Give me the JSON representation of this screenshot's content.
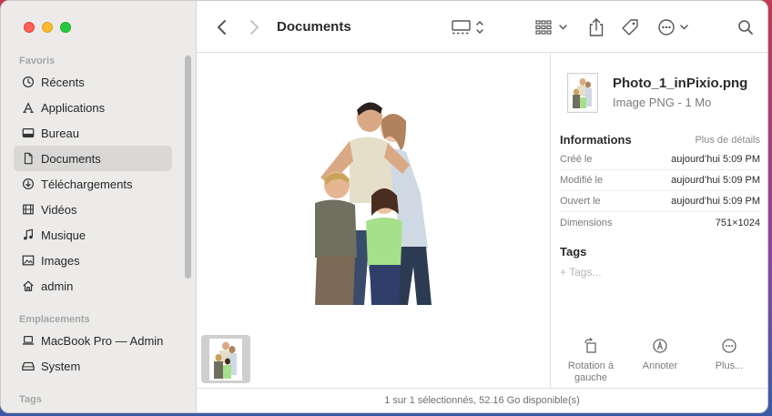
{
  "window": {
    "title": "Documents"
  },
  "sidebar": {
    "sections": {
      "favorites": "Favoris",
      "locations": "Emplacements",
      "tags": "Tags"
    },
    "favorites": [
      {
        "label": "Récents",
        "icon": "clock-icon"
      },
      {
        "label": "Applications",
        "icon": "applications-icon"
      },
      {
        "label": "Bureau",
        "icon": "desktop-icon"
      },
      {
        "label": "Documents",
        "icon": "document-icon",
        "selected": true
      },
      {
        "label": "Téléchargements",
        "icon": "download-icon"
      },
      {
        "label": "Vidéos",
        "icon": "film-icon"
      },
      {
        "label": "Musique",
        "icon": "music-note-icon"
      },
      {
        "label": "Images",
        "icon": "photo-icon"
      },
      {
        "label": "admin",
        "icon": "home-icon"
      }
    ],
    "locations": [
      {
        "label": "MacBook Pro — Admin",
        "icon": "laptop-icon"
      },
      {
        "label": "System",
        "icon": "drive-icon"
      }
    ]
  },
  "toolbar": {
    "back_icon": "chevron-left-icon",
    "forward_icon": "chevron-right-icon",
    "view_icon": "gallery-view-icon",
    "group_icon": "grid-group-icon",
    "share_icon": "share-icon",
    "tag_icon": "tag-icon",
    "more_icon": "ellipsis-circle-icon",
    "search_icon": "search-icon"
  },
  "info": {
    "file_name": "Photo_1_inPixio.png",
    "file_kind": "Image PNG - 1 Mo",
    "section_title": "Informations",
    "more_details": "Plus de détails",
    "rows": [
      {
        "key": "Créé le",
        "value": "aujourd’hui 5:09 PM"
      },
      {
        "key": "Modifié le",
        "value": "aujourd’hui 5:09 PM"
      },
      {
        "key": "Ouvert le",
        "value": "aujourd’hui 5:09 PM"
      },
      {
        "key": "Dimensions",
        "value": "751×1024"
      }
    ],
    "tags_title": "Tags",
    "tags_placeholder": "+ Tags..."
  },
  "actions": [
    {
      "label": "Rotation à gauche",
      "icon": "rotate-left-icon"
    },
    {
      "label": "Annoter",
      "icon": "markup-icon"
    },
    {
      "label": "Plus...",
      "icon": "more-icon"
    }
  ],
  "status": {
    "text": "1 sur 1 sélectionnés, 52.16 Go disponible(s)"
  }
}
